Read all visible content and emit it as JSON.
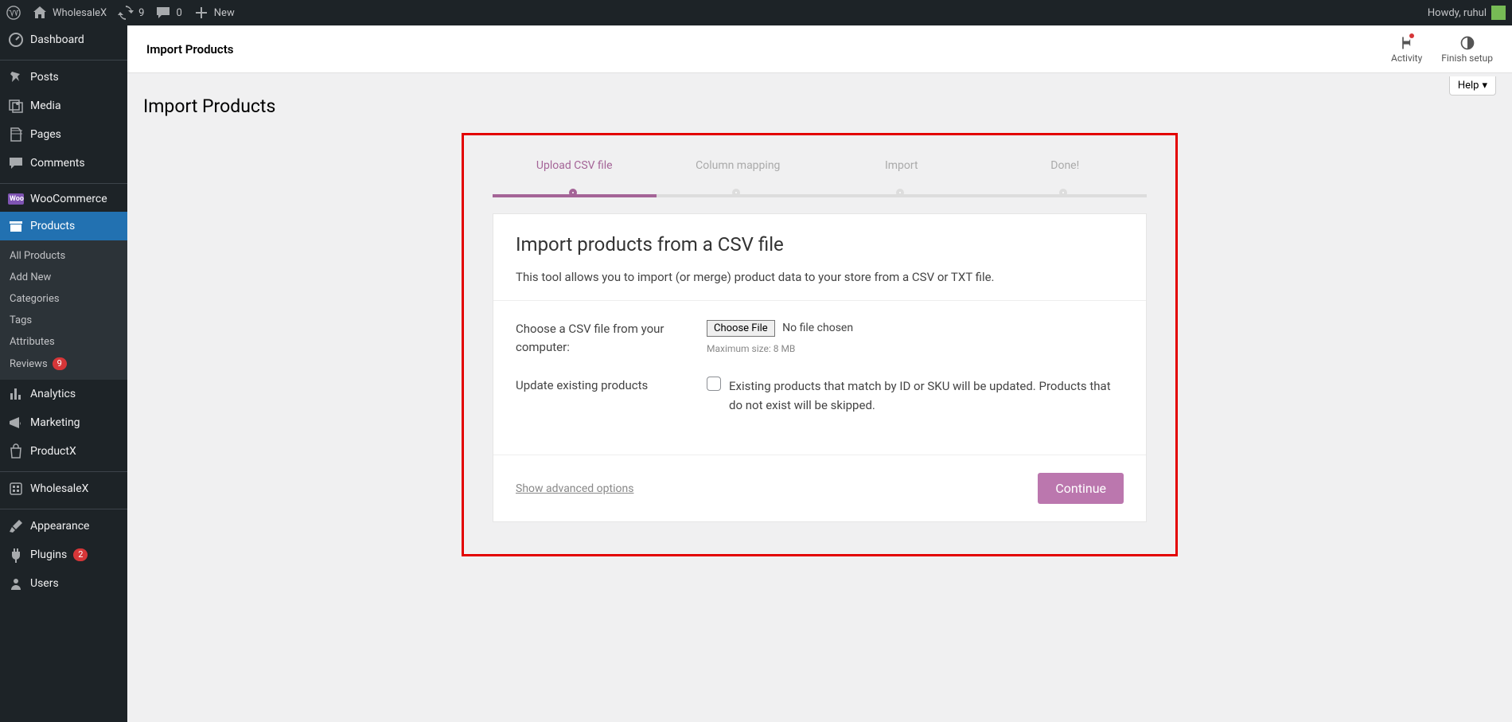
{
  "adminbar": {
    "site_name": "WholesaleX",
    "updates": "9",
    "comments": "0",
    "new": "New",
    "howdy": "Howdy, ruhul"
  },
  "sidebar": {
    "dashboard": "Dashboard",
    "posts": "Posts",
    "media": "Media",
    "pages": "Pages",
    "comments": "Comments",
    "woocommerce": "WooCommerce",
    "products": "Products",
    "submenu": {
      "all": "All Products",
      "add": "Add New",
      "categories": "Categories",
      "tags": "Tags",
      "attributes": "Attributes",
      "reviews": "Reviews",
      "reviews_count": "9"
    },
    "analytics": "Analytics",
    "marketing": "Marketing",
    "productx": "ProductX",
    "wholesalex": "WholesaleX",
    "appearance": "Appearance",
    "plugins": "Plugins",
    "plugins_count": "2",
    "users": "Users"
  },
  "topbar": {
    "title": "Import Products",
    "activity": "Activity",
    "finish_setup": "Finish setup"
  },
  "page": {
    "help": "Help",
    "h1": "Import Products",
    "steps": [
      "Upload CSV file",
      "Column mapping",
      "Import",
      "Done!"
    ],
    "card": {
      "title": "Import products from a CSV file",
      "desc": "This tool allows you to import (or merge) product data to your store from a CSV or TXT file.",
      "choose_label": "Choose a CSV file from your computer:",
      "choose_btn": "Choose File",
      "no_file": "No file chosen",
      "max_size": "Maximum size: 8 MB",
      "update_label": "Update existing products",
      "update_desc": "Existing products that match by ID or SKU will be updated. Products that do not exist will be skipped.",
      "advanced": "Show advanced options",
      "continue": "Continue"
    }
  }
}
